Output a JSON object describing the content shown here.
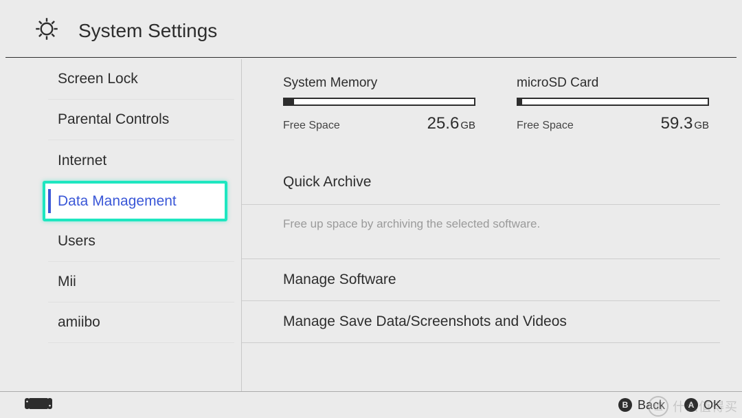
{
  "header": {
    "title": "System Settings"
  },
  "sidebar": {
    "items": [
      {
        "label": "Screen Lock"
      },
      {
        "label": "Parental Controls"
      },
      {
        "label": "Internet"
      },
      {
        "label": "Data Management"
      },
      {
        "label": "Users"
      },
      {
        "label": "Mii"
      },
      {
        "label": "amiibo"
      }
    ],
    "selected_index": 3
  },
  "storage": {
    "system": {
      "title": "System Memory",
      "free_label": "Free Space",
      "value": "25.6",
      "unit": "GB",
      "used_pct": 5
    },
    "sd": {
      "title": "microSD Card",
      "free_label": "Free Space",
      "value": "59.3",
      "unit": "GB",
      "used_pct": 2
    }
  },
  "detail": {
    "quick_archive": {
      "title": "Quick Archive",
      "desc": "Free up space by archiving the selected software."
    },
    "manage_software": "Manage Software",
    "manage_save": "Manage Save Data/Screenshots and Videos"
  },
  "footer": {
    "b": {
      "glyph": "B",
      "label": "Back"
    },
    "a": {
      "glyph": "A",
      "label": "OK"
    }
  },
  "watermark": {
    "glyph": "值",
    "text": "什么值得买"
  }
}
